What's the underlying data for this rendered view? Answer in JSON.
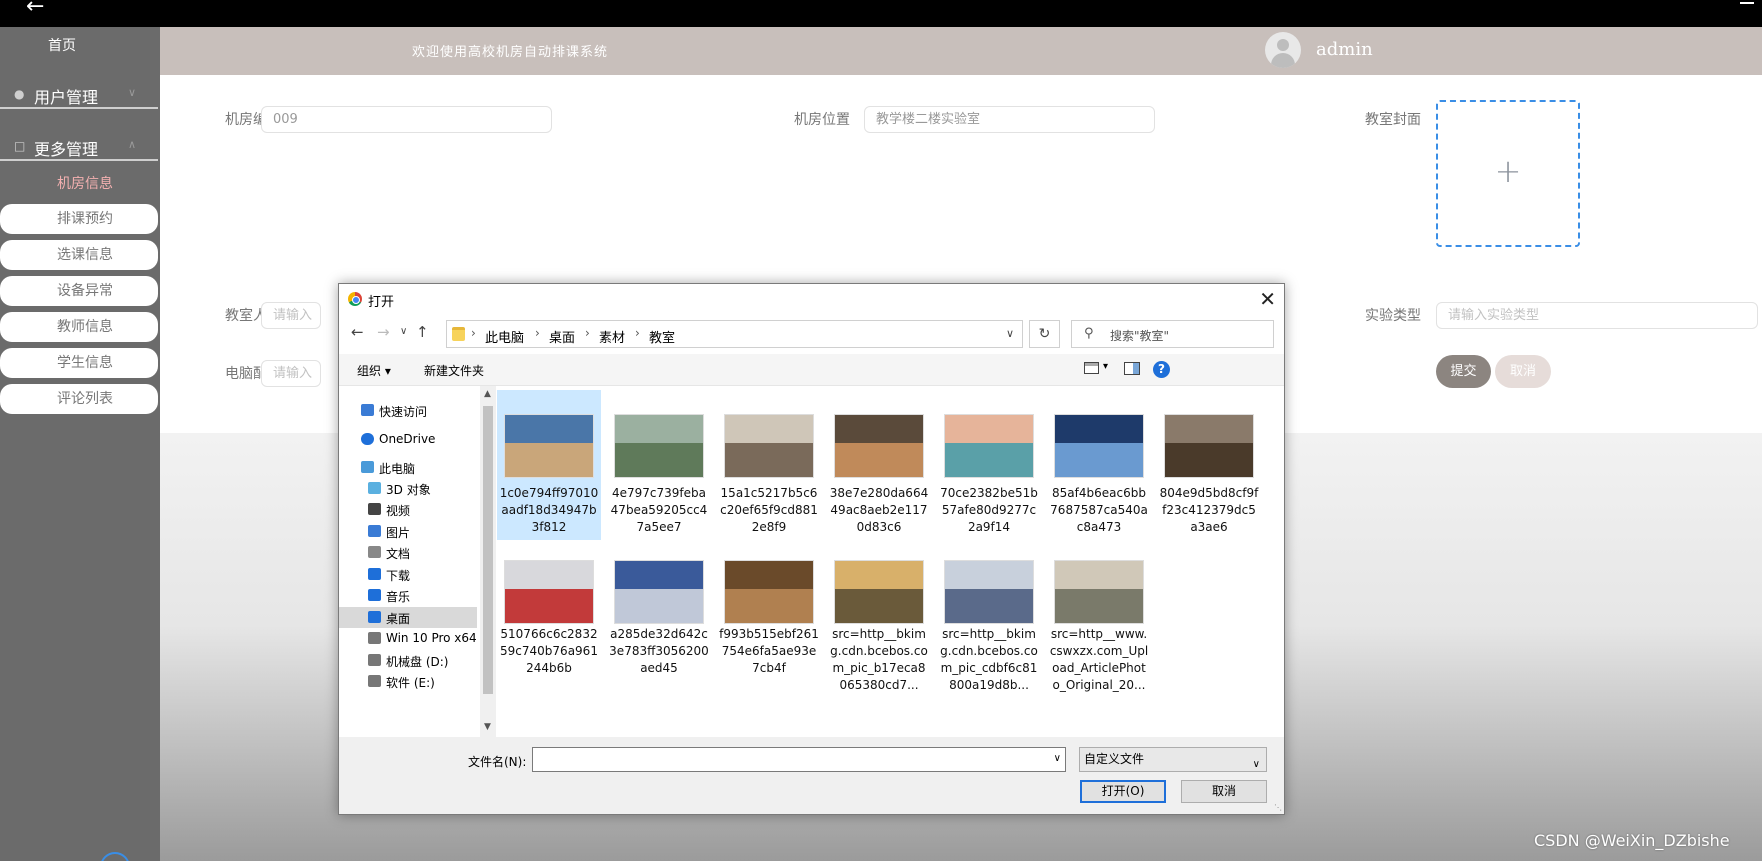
{
  "topbar": {
    "back_glyph": "←"
  },
  "sidebar": {
    "home": "首页",
    "groups": [
      {
        "label": "用户管理",
        "icon": "user-icon"
      },
      {
        "label": "更多管理",
        "icon": "copy-icon"
      }
    ],
    "items": [
      {
        "label": "机房信息",
        "active": true
      },
      {
        "label": "排课预约"
      },
      {
        "label": "选课信息"
      },
      {
        "label": "设备异常"
      },
      {
        "label": "教师信息"
      },
      {
        "label": "学生信息"
      },
      {
        "label": "评论列表"
      }
    ]
  },
  "header": {
    "welcome": "欢迎使用高校机房自动排课系统",
    "username": "admin"
  },
  "form": {
    "room_no_label": "机房编号",
    "room_no_value": "009",
    "location_label": "机房位置",
    "location_value": "教学楼二楼实验室",
    "cover_label": "教室封面",
    "capacity_label": "教室人数",
    "capacity_placeholder": "请输入",
    "pc_config_label": "电脑配置",
    "pc_config_placeholder": "请输入",
    "exp_type_label": "实验类型",
    "exp_type_placeholder": "请输入实验类型",
    "submit": "提交",
    "cancel": "取消"
  },
  "dialog": {
    "title": "打开",
    "breadcrumb": [
      "此电脑",
      "桌面",
      "素材",
      "教室"
    ],
    "search_placeholder": "搜索\"教室\"",
    "organize": "组织",
    "new_folder": "新建文件夹",
    "nav": [
      {
        "label": "快速访问",
        "icon": "star-icon"
      },
      {
        "label": "OneDrive",
        "icon": "cloud-icon"
      },
      {
        "label": "此电脑",
        "icon": "computer-icon"
      },
      {
        "label": "3D 对象",
        "icon": "cube-icon"
      },
      {
        "label": "视频",
        "icon": "video-icon"
      },
      {
        "label": "图片",
        "icon": "picture-icon"
      },
      {
        "label": "文档",
        "icon": "document-icon"
      },
      {
        "label": "下载",
        "icon": "download-icon"
      },
      {
        "label": "音乐",
        "icon": "music-icon"
      },
      {
        "label": "桌面",
        "icon": "desktop-icon",
        "selected": true
      },
      {
        "label": "Win 10 Pro x64",
        "icon": "drive-icon"
      },
      {
        "label": "机械盘 (D:)",
        "icon": "drive-icon"
      },
      {
        "label": "软件 (E:)",
        "icon": "drive-icon"
      }
    ],
    "files": [
      {
        "name": "1c0e794ff97010aadf18d34947b3f812",
        "selected": true,
        "colors": [
          "#4a76a8",
          "#c9a67a"
        ]
      },
      {
        "name": "4e797c739feba47bea59205cc47a5ee7",
        "colors": [
          "#9bb0a0",
          "#5f7a5a"
        ]
      },
      {
        "name": "15a1c5217b5c6c20ef65f9cd8812e8f9",
        "colors": [
          "#cfc6b8",
          "#7a6a5a"
        ]
      },
      {
        "name": "38e7e280da66449ac8aeb2e1170d83c6",
        "colors": [
          "#5a4a3a",
          "#c08a5a"
        ]
      },
      {
        "name": "70ce2382be51b57afe80d9277c2a9f14",
        "colors": [
          "#e6b49a",
          "#5aa0a8"
        ]
      },
      {
        "name": "85af4b6eac6bb7687587ca540ac8a473",
        "colors": [
          "#1e3a6a",
          "#6a9ad0"
        ]
      },
      {
        "name": "804e9d5bd8cf9ff23c412379dc5a3ae6",
        "colors": [
          "#8a7a6a",
          "#4a3a2a"
        ]
      },
      {
        "name": "510766c6c283259c740b76a961244b6b",
        "colors": [
          "#d8d8dc",
          "#c23a3a"
        ]
      },
      {
        "name": "a285de32d642c3e783ff3056200aed45",
        "colors": [
          "#3a5a9a",
          "#c0c8d8"
        ]
      },
      {
        "name": "f993b515ebf261754e6fa5ae93e7cb4f",
        "colors": [
          "#6a4a2a",
          "#b08050"
        ]
      },
      {
        "name": "src=http__bkimg.cdn.bcebos.com_pic_b17eca8065380cd7...",
        "colors": [
          "#d8b06a",
          "#6a5a3a"
        ]
      },
      {
        "name": "src=http__bkimg.cdn.bcebos.com_pic_cdbf6c81800a19d8b...",
        "colors": [
          "#c8d0dc",
          "#5a6a8a"
        ]
      },
      {
        "name": "src=http__www.cswxzx.com_Upload_ArticlePhoto_Original_20...",
        "colors": [
          "#d0c8b8",
          "#7a7a6a"
        ]
      }
    ],
    "filename_label": "文件名(N):",
    "filename_value": "",
    "filetype": "自定义文件",
    "open_btn": "打开(O)",
    "cancel_btn": "取消"
  },
  "watermark": "CSDN @WeiXin_DZbishe"
}
